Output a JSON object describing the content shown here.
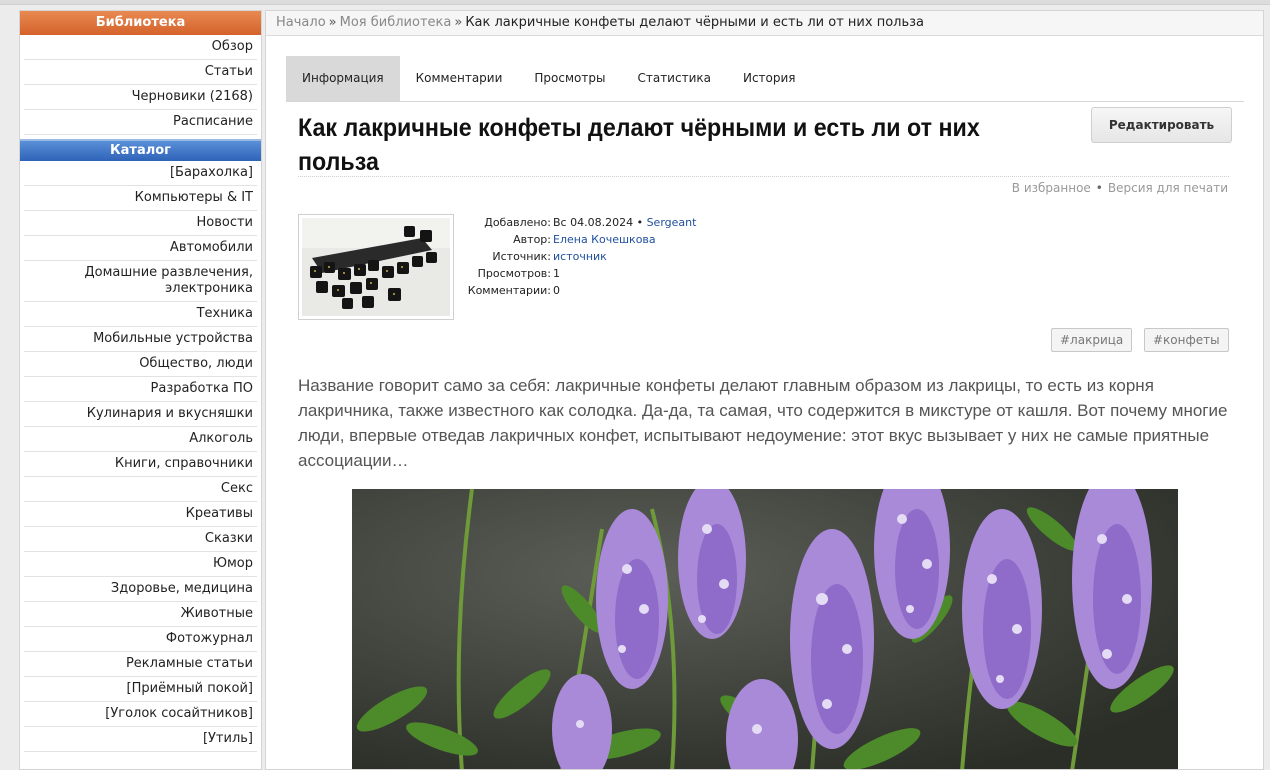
{
  "sidebar": {
    "library_title": "Библиотека",
    "library_items": [
      "Обзор",
      "Статьи",
      "Черновики (2168)",
      "Расписание"
    ],
    "catalog_title": "Каталог",
    "catalog_items": [
      "[Барахолка]",
      "Компьютеры & IT",
      "Новости",
      "Автомобили",
      "Домашние развлечения, электроника",
      "Техника",
      "Мобильные устройства",
      "Общество, люди",
      "Разработка ПО",
      "Кулинария и вкусняшки",
      "Алкоголь",
      "Книги, справочники",
      "Секс",
      "Креативы",
      "Сказки",
      "Юмор",
      "Здоровье, медицина",
      "Животные",
      "Фотожурнал",
      "Рекламные статьи",
      "[Приёмный покой]",
      "[Уголок сосайтников]",
      "[Утиль]"
    ]
  },
  "breadcrumb": {
    "home": "Начало",
    "library": "Моя библиотека",
    "current": "Как лакричные конфеты делают чёрными и есть ли от них польза"
  },
  "tabs": [
    "Информация",
    "Комментарии",
    "Просмотры",
    "Статистика",
    "История"
  ],
  "article": {
    "title": "Как лакричные конфеты делают чёрными и есть ли от них польза",
    "edit_label": "Редактировать",
    "favorite_label": "В избранное",
    "print_label": "Версия для печати",
    "meta": {
      "added_label": "Добавлено:",
      "added_value": "Вс 04.08.2024",
      "added_user": "Sergeant",
      "author_label": "Автор:",
      "author_value": "Елена Кочешкова",
      "source_label": "Источник:",
      "source_value": "источник",
      "views_label": "Просмотров:",
      "views_value": "1",
      "comments_label": "Комментарии:",
      "comments_value": "0"
    },
    "tags": [
      "#лакрица",
      "#конфеты"
    ],
    "intro": "Название говорит само за себя: лакричные конфеты делают главным образом из лакрицы, то есть из корня лакричника, также известного как солодка. Да-да, та самая, что содержится в микстуре от кашля. Вот почему многие люди, впервые отведав лакричных конфет, испытывают недоумение: этот вкус вызывает у них не самые приятные ассоциации…"
  },
  "colors": {
    "library_header": "#d4622a",
    "catalog_header": "#2e63b8",
    "link_blue": "#1f4e9b"
  }
}
